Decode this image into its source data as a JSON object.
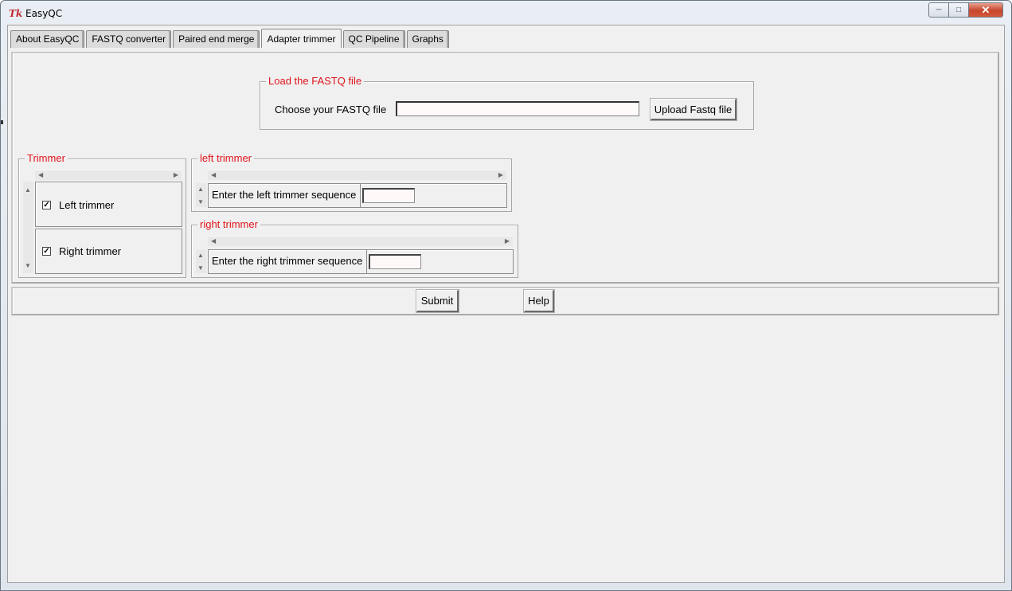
{
  "window": {
    "title": "EasyQC",
    "icon": "tk-feather-icon",
    "controls": {
      "minimize": "minimize-icon",
      "maximize": "maximize-icon",
      "close": "close-icon"
    }
  },
  "tabs": [
    {
      "label": "About EasyQC",
      "active": false
    },
    {
      "label": "FASTQ converter",
      "active": false
    },
    {
      "label": "Paired end merge",
      "active": false
    },
    {
      "label": "Adapter trimmer",
      "active": true
    },
    {
      "label": "QC Pipeline",
      "active": false
    },
    {
      "label": "Graphs",
      "active": false
    }
  ],
  "load_file": {
    "legend": "Load the FASTQ file",
    "choose_label": "Choose your FASTQ file",
    "file_value": "",
    "upload_button": "Upload Fastq file"
  },
  "trimmer": {
    "legend": "Trimmer",
    "options": [
      {
        "label": "Left trimmer",
        "checked": true
      },
      {
        "label": "Right trimmer",
        "checked": true
      }
    ]
  },
  "left_trimmer": {
    "legend": "left trimmer",
    "label": "Enter the left trimmer sequence",
    "value": ""
  },
  "right_trimmer": {
    "legend": "right trimmer",
    "label": "Enter the right trimmer sequence",
    "value": ""
  },
  "actions": {
    "submit": "Submit",
    "help": "Help"
  },
  "colors": {
    "legend_text": "#e0141c",
    "panel_bg": "#f0f0f0",
    "input_bg": "#fff8f8"
  }
}
